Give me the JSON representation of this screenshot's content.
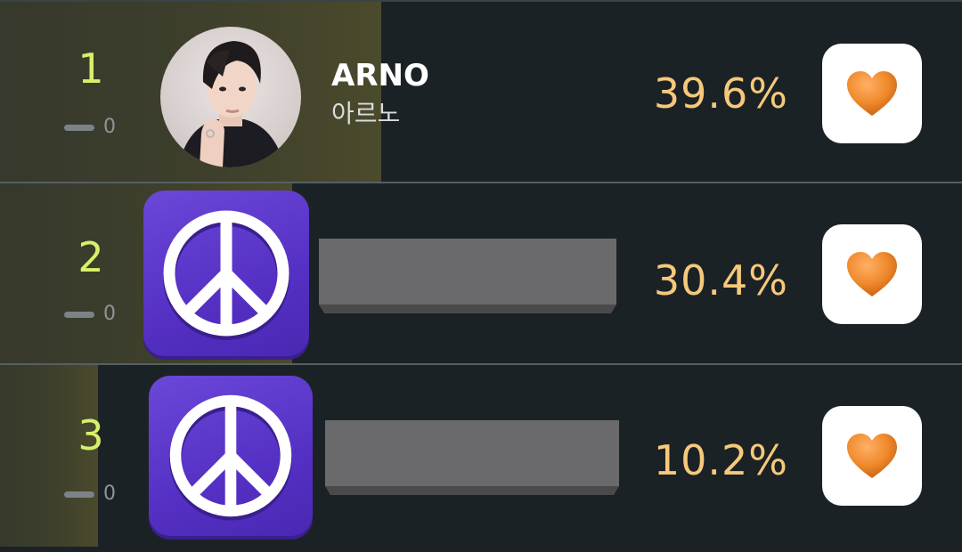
{
  "colors": {
    "rank_number": "#d6f06a",
    "percentage": "#f6c97a",
    "heart": "#f08a2c",
    "peace_tile": "#5a36c8",
    "background": "#1b2226"
  },
  "rankings": [
    {
      "rank": "1",
      "rank_change": "0",
      "name": "ARNO",
      "name_kr": "아르노",
      "percentage": "39.6%",
      "vote_share": 0.396,
      "avatar": "photo",
      "action_icon": "heart-icon"
    },
    {
      "rank": "2",
      "rank_change": "0",
      "percentage": "30.4%",
      "vote_share": 0.304,
      "avatar": "peace-icon",
      "action_icon": "heart-icon"
    },
    {
      "rank": "3",
      "rank_change": "0",
      "percentage": "10.2%",
      "vote_share": 0.102,
      "avatar": "peace-icon",
      "action_icon": "heart-icon"
    }
  ]
}
